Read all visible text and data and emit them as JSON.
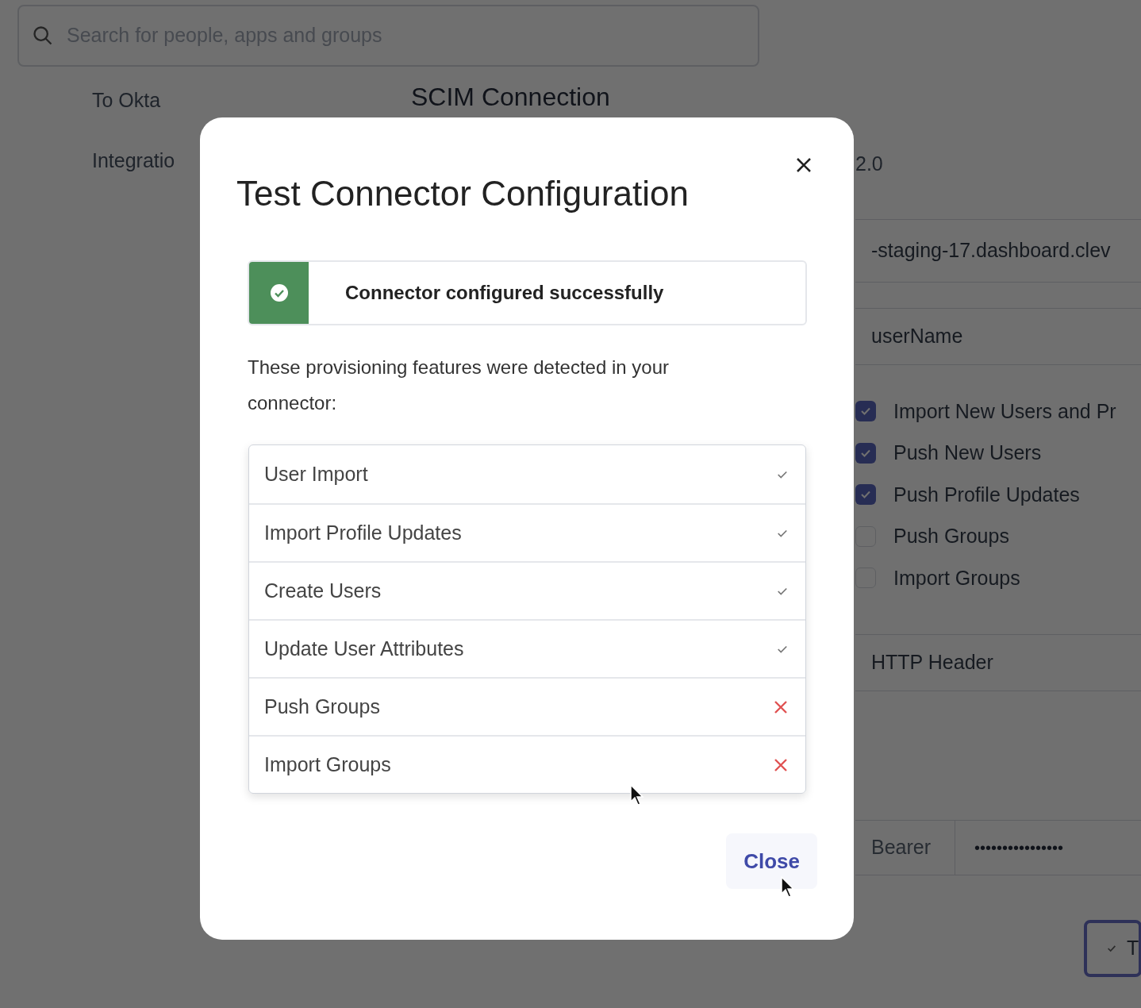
{
  "search": {
    "placeholder": "Search for people, apps and groups"
  },
  "nav": [
    "To Okta",
    "Integratio"
  ],
  "page_title": "SCIM Connection",
  "settings": {
    "version_fragment": "2.0",
    "base_url": "-staging-17.dashboard.clev",
    "unique_identifier": "userName",
    "actions": [
      {
        "label": "Import New Users and Pr",
        "checked": true
      },
      {
        "label": "Push New Users",
        "checked": true
      },
      {
        "label": "Push Profile Updates",
        "checked": true
      },
      {
        "label": "Push Groups",
        "checked": false
      },
      {
        "label": "Import Groups",
        "checked": false
      }
    ],
    "auth_mode": "HTTP Header",
    "token_type": "Bearer",
    "token": "••••••••••••••••",
    "test_button": "T"
  },
  "dialog": {
    "title": "Test Connector Configuration",
    "status": {
      "kind": "success",
      "message": "Connector configured successfully"
    },
    "description": "These provisioning features were detected in your connector:",
    "features": [
      {
        "label": "User Import",
        "supported": true
      },
      {
        "label": "Import Profile Updates",
        "supported": true
      },
      {
        "label": "Create Users",
        "supported": true
      },
      {
        "label": "Update User Attributes",
        "supported": true
      },
      {
        "label": "Push Groups",
        "supported": false
      },
      {
        "label": "Import Groups",
        "supported": false
      }
    ],
    "close_button": "Close"
  }
}
